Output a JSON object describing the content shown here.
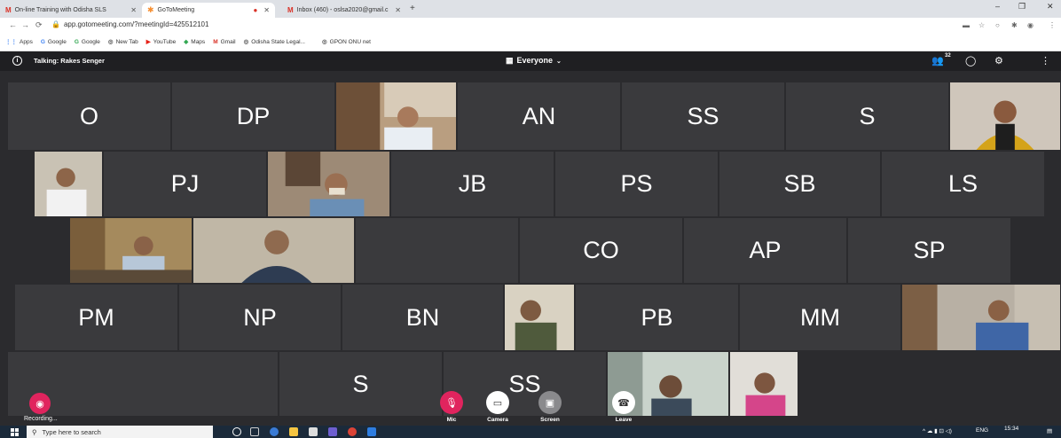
{
  "browser": {
    "tabs": [
      {
        "label": "On-line Training with Odisha SLS",
        "icon": "gmail-icon"
      },
      {
        "label": "GoToMeeting",
        "icon": "gotomeeting-icon"
      },
      {
        "label": "Inbox (460) - oslsa2020@gmail.c",
        "icon": "gmail-icon"
      }
    ],
    "url": "app.gotomeeting.com/?meetingId=425512101",
    "bookmarks": [
      "Apps",
      "Google",
      "Google",
      "New Tab",
      "YouTube",
      "Maps",
      "Gmail",
      "Odisha State Legal...",
      "GPON ONU net"
    ]
  },
  "meeting": {
    "talking": "Talking: Rakes Senger",
    "view": "Everyone",
    "attendee_count": "32"
  },
  "tiles": [
    {
      "label": "O"
    },
    {
      "label": "DP"
    },
    {
      "label": ""
    },
    {
      "label": "AN"
    },
    {
      "label": "SS"
    },
    {
      "label": "S"
    },
    {
      "label": ""
    },
    {
      "label": ""
    },
    {
      "label": "PJ"
    },
    {
      "label": ""
    },
    {
      "label": "JB"
    },
    {
      "label": "PS"
    },
    {
      "label": "SB"
    },
    {
      "label": "LS"
    },
    {
      "label": ""
    },
    {
      "label": ""
    },
    {
      "label": ""
    },
    {
      "label": "CO"
    },
    {
      "label": "AP"
    },
    {
      "label": "SP"
    },
    {
      "label": "PM"
    },
    {
      "label": "NP"
    },
    {
      "label": "BN"
    },
    {
      "label": ""
    },
    {
      "label": "PB"
    },
    {
      "label": "MM"
    },
    {
      "label": ""
    },
    {
      "label": ""
    },
    {
      "label": "S"
    },
    {
      "label": "SS"
    },
    {
      "label": ""
    },
    {
      "label": ""
    }
  ],
  "controls": {
    "recording": "Recording...",
    "mic": "Mic",
    "camera": "Camera",
    "screen": "Screen",
    "leave": "Leave"
  },
  "taskbar": {
    "search_placeholder": "Type here to search",
    "lang": "ENG",
    "time": "15:34"
  },
  "colors": {
    "record": "#e0245e",
    "mic": "#e0245e",
    "leave": "#3a3a3d",
    "accent": "#f68d2e"
  }
}
